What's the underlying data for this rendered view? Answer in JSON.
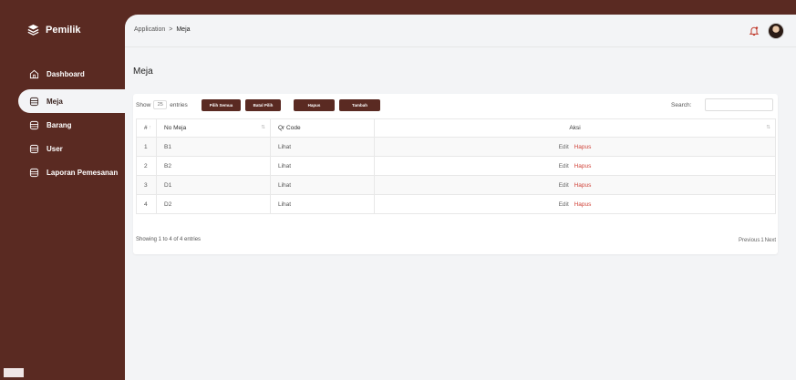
{
  "sidebar": {
    "brand": "Pemilik",
    "items": [
      {
        "label": "Dashboard",
        "icon": "home-icon"
      },
      {
        "label": "Meja",
        "icon": "database-icon",
        "active": true
      },
      {
        "label": "Barang",
        "icon": "database-icon"
      },
      {
        "label": "User",
        "icon": "database-icon"
      },
      {
        "label": "Laporan Pemesanan",
        "icon": "database-icon"
      }
    ]
  },
  "header": {
    "breadcrumb_root": "Application",
    "breadcrumb_sep": ">",
    "breadcrumb_current": "Meja"
  },
  "page": {
    "title": "Meja"
  },
  "controls": {
    "show_label": "Show",
    "entries_value": "25",
    "entries_label": "entries",
    "buttons": [
      "Pilih Semua",
      "Batal Pilih",
      "Hapus",
      "Tambah"
    ],
    "search_label": "Search:",
    "search_value": ""
  },
  "table": {
    "columns": [
      "#",
      "No Meja",
      "Qr Code",
      "Aksi"
    ],
    "rows": [
      {
        "no": "1",
        "meja": "B1",
        "qr": "Lihat",
        "edit": "Edit",
        "hapus": "Hapus"
      },
      {
        "no": "2",
        "meja": "B2",
        "qr": "Lihat",
        "edit": "Edit",
        "hapus": "Hapus"
      },
      {
        "no": "3",
        "meja": "D1",
        "qr": "Lihat",
        "edit": "Edit",
        "hapus": "Hapus"
      },
      {
        "no": "4",
        "meja": "D2",
        "qr": "Lihat",
        "edit": "Edit",
        "hapus": "Hapus"
      }
    ]
  },
  "footer": {
    "info": "Showing 1 to 4 of 4 entries",
    "previous": "Previous",
    "current_page": "1",
    "next": "Next"
  },
  "colors": {
    "brand": "#5a2a22",
    "danger": "#d0443a",
    "content_bg": "#f3f4f6"
  }
}
